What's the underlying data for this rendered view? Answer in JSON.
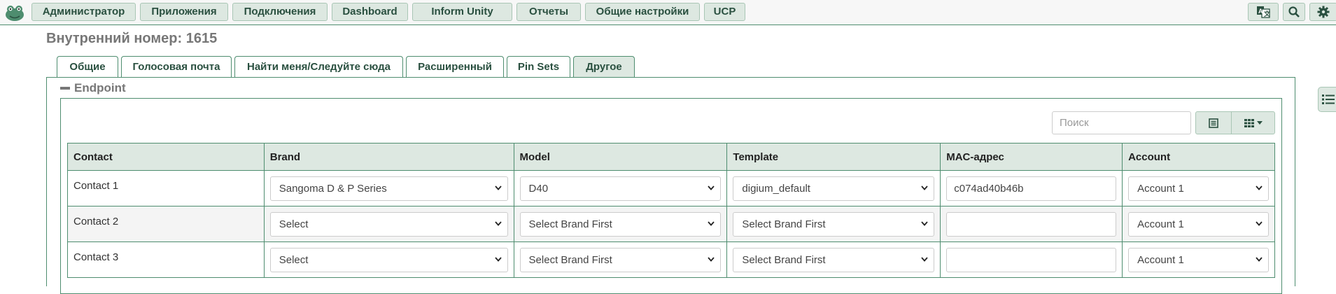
{
  "nav": {
    "items": [
      "Администратор",
      "Приложения",
      "Подключения",
      "Dashboard",
      "Inform Unity",
      "Отчеты",
      "Общие настройки",
      "UCP"
    ]
  },
  "icons": {
    "logo": "frog-logo-icon",
    "right": [
      "translate-icon",
      "search-icon",
      "gear-icon"
    ],
    "table_tools": [
      "list-view-icon",
      "grid-columns-icon"
    ],
    "side": "list-icon"
  },
  "colors": {
    "accent": "#4e8d6f",
    "button_bg": "#dde8e1",
    "header_bg": "#dde8e1"
  },
  "page": {
    "title": "Внутренний номер: 1615"
  },
  "tabs": [
    {
      "label": "Общие",
      "active": false
    },
    {
      "label": "Голосовая почта",
      "active": false
    },
    {
      "label": "Найти меня/Следуйте сюда",
      "active": false
    },
    {
      "label": "Расширенный",
      "active": false
    },
    {
      "label": "Pin Sets",
      "active": false
    },
    {
      "label": "Другое",
      "active": true
    }
  ],
  "section": {
    "title": "Endpoint"
  },
  "search": {
    "placeholder": "Поиск"
  },
  "table": {
    "headers": [
      "Contact",
      "Brand",
      "Model",
      "Template",
      "MAC-адрес",
      "Account"
    ],
    "rows": [
      {
        "contact": "Contact 1",
        "brand": "Sangoma D & P Series",
        "model": "D40",
        "template": "digium_default",
        "mac": "c074ad40b46b",
        "account": "Account 1"
      },
      {
        "contact": "Contact 2",
        "brand": "Select",
        "model": "Select Brand First",
        "template": "Select Brand First",
        "mac": "",
        "account": "Account 1"
      },
      {
        "contact": "Contact 3",
        "brand": "Select",
        "model": "Select Brand First",
        "template": "Select Brand First",
        "mac": "",
        "account": "Account 1"
      }
    ]
  }
}
